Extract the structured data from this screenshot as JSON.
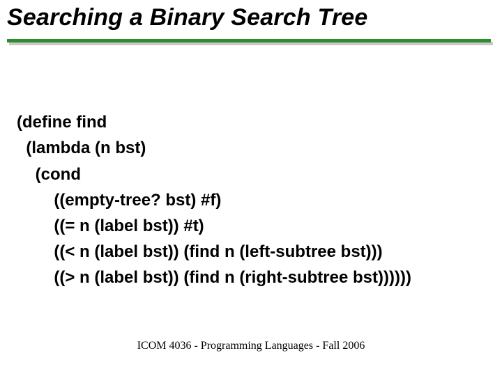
{
  "title": "Searching a Binary Search Tree",
  "code": {
    "l1": "(define find",
    "l2": "  (lambda (n bst)",
    "l3": "    (cond",
    "l4": "        ((empty-tree? bst) #f)",
    "l5": "        ((= n (label bst)) #t)",
    "l6": "        ((< n (label bst)) (find n (left-subtree bst)))",
    "l7": "        ((> n (label bst)) (find n (right-subtree bst))))))"
  },
  "footer": "ICOM 4036 - Programming Languages - Fall 2006"
}
